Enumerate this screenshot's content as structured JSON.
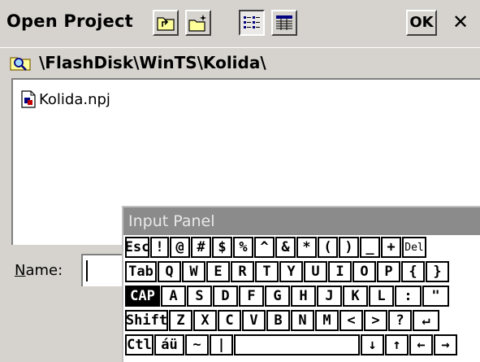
{
  "titlebar": {
    "title": "Open Project",
    "buttons": {
      "up_folder": "up-folder-icon",
      "new_folder": "new-folder-icon",
      "list_view": "list-view-icon",
      "details_view": "details-view-icon"
    },
    "ok_label": "OK",
    "close_label": "✕"
  },
  "path": {
    "icon": "folder-search-icon",
    "text": "\\FlashDisk\\WinTS\\Kolida\\"
  },
  "files": [
    {
      "name": "Kolida.npj",
      "icon": "project-file-icon"
    }
  ],
  "name_field": {
    "label_underlined": "N",
    "label_rest": "ame:",
    "value": ""
  },
  "input_panel": {
    "title": "Input Panel",
    "rows": [
      [
        "Esc",
        "!",
        "@",
        "#",
        "$",
        "%",
        "^",
        "&",
        "*",
        "(",
        ")",
        "_",
        "+",
        "Del"
      ],
      [
        "Tab",
        "Q",
        "W",
        "E",
        "R",
        "T",
        "Y",
        "U",
        "I",
        "O",
        "P",
        "{",
        "}"
      ],
      [
        "CAP",
        "A",
        "S",
        "D",
        "F",
        "G",
        "H",
        "J",
        "K",
        "L",
        ":",
        "\""
      ],
      [
        "Shift",
        "Z",
        "X",
        "C",
        "V",
        "B",
        "N",
        "M",
        "<",
        ">",
        "?",
        "↵"
      ],
      [
        "Ctl",
        "áü",
        "~",
        "|",
        "",
        "↓",
        "↑",
        "←",
        "→"
      ]
    ]
  }
}
